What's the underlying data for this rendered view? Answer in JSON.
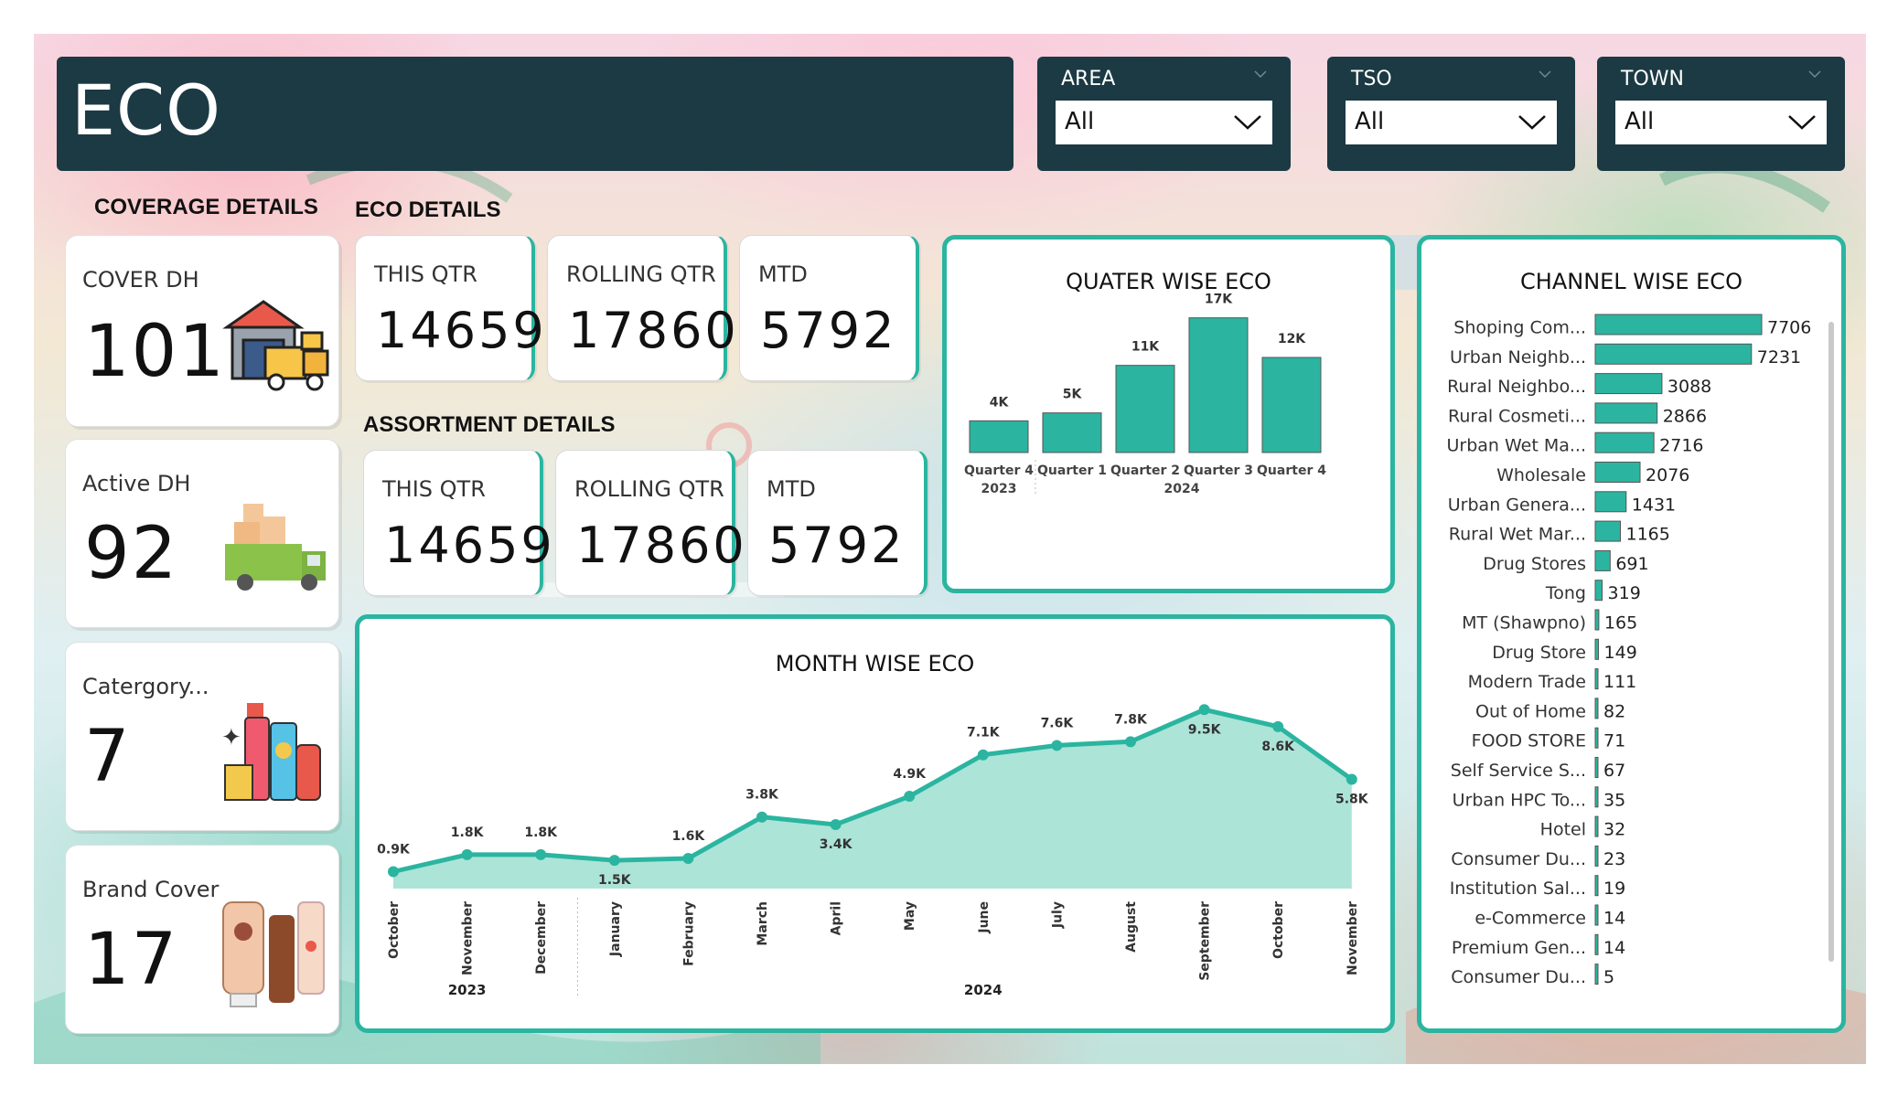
{
  "header": {
    "title": "ECO"
  },
  "filters": [
    {
      "label": "AREA",
      "value": "All"
    },
    {
      "label": "TSO",
      "value": "All"
    },
    {
      "label": "TOWN",
      "value": "All"
    }
  ],
  "sections": {
    "coverage": "COVERAGE DETAILS",
    "eco": "ECO DETAILS",
    "assortment": "ASSORTMENT DETAILS"
  },
  "coverage_cards": [
    {
      "title": "COVER DH",
      "value": "101",
      "icon": "warehouse-truck-icon"
    },
    {
      "title": "Active DH",
      "value": "92",
      "icon": "delivery-truck-icon"
    },
    {
      "title": "Catergory...",
      "value": "7",
      "icon": "cosmetics-icon"
    },
    {
      "title": "Brand Cover",
      "value": "17",
      "icon": "cosmetic-tubes-icon"
    }
  ],
  "eco_kpis": [
    {
      "title": "THIS QTR",
      "value": "14659"
    },
    {
      "title": "ROLLING QTR",
      "value": "17860"
    },
    {
      "title": "MTD",
      "value": "5792"
    }
  ],
  "assortment_kpis": [
    {
      "title": "THIS QTR",
      "value": "14659"
    },
    {
      "title": "ROLLING QTR",
      "value": "17860"
    },
    {
      "title": "MTD",
      "value": "5792"
    }
  ],
  "colors": {
    "accent": "#2bb5a0",
    "header_bg": "#1b3a43",
    "area_fill": "#a8e3d6"
  },
  "chart_data": [
    {
      "type": "bar",
      "title": "QUATER WISE ECO",
      "categories": [
        "Quarter 4",
        "Quarter 1",
        "Quarter 2",
        "Quarter 3",
        "Quarter 4"
      ],
      "year_groups": [
        {
          "label": "2023",
          "quarters": 1
        },
        {
          "label": "2024",
          "quarters": 4
        }
      ],
      "values": [
        4000,
        5000,
        11000,
        17000,
        12000
      ],
      "data_labels": [
        "4K",
        "5K",
        "11K",
        "17K",
        "12K"
      ],
      "ylim": [
        0,
        18000
      ]
    },
    {
      "type": "area",
      "title": "MONTH WISE ECO",
      "categories": [
        "October",
        "November",
        "December",
        "January",
        "February",
        "March",
        "April",
        "May",
        "June",
        "July",
        "August",
        "September",
        "October",
        "November"
      ],
      "year_groups": [
        {
          "label": "2023",
          "months": 3
        },
        {
          "label": "2024",
          "months": 11
        }
      ],
      "values": [
        900,
        1800,
        1800,
        1500,
        1600,
        3800,
        3400,
        4900,
        7100,
        7600,
        7800,
        9500,
        8600,
        5800
      ],
      "data_labels": [
        "0.9K",
        "1.8K",
        "1.8K",
        "1.5K",
        "1.6K",
        "3.8K",
        "3.4K",
        "4.9K",
        "7.1K",
        "7.6K",
        "7.8K",
        "9.5K",
        "8.6K",
        "5.8K"
      ],
      "ylim": [
        0,
        10000
      ]
    },
    {
      "type": "bar",
      "orientation": "horizontal",
      "title": "CHANNEL WISE ECO",
      "categories": [
        "Shoping Com...",
        "Urban Neighb...",
        "Rural Neighbo...",
        "Rural Cosmeti...",
        "Urban Wet Ma...",
        "Wholesale",
        "Urban Genera...",
        "Rural Wet Mar...",
        "Drug Stores",
        "Tong",
        "MT (Shawpno)",
        "Drug Store",
        "Modern Trade",
        "Out of Home",
        "FOOD STORE",
        "Self Service S...",
        "Urban HPC To...",
        "Hotel",
        "Consumer Du...",
        "Institution Sal...",
        "e-Commerce",
        "Premium Gen...",
        "Consumer Du..."
      ],
      "values": [
        7706,
        7231,
        3088,
        2866,
        2716,
        2076,
        1431,
        1165,
        691,
        319,
        165,
        149,
        111,
        82,
        71,
        67,
        35,
        32,
        23,
        19,
        14,
        14,
        5
      ],
      "xlim": [
        0,
        7706
      ]
    }
  ]
}
